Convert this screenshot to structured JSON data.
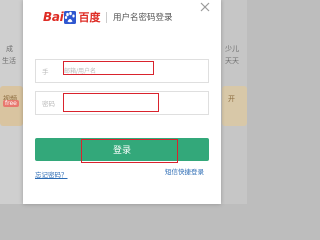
{
  "background": {
    "left_texts": [
      "成",
      "生活"
    ],
    "right_texts": [
      "少儿",
      "天天"
    ],
    "left_card_text": "视频",
    "right_card_text": "开",
    "badge_text": "free"
  },
  "modal": {
    "logo": {
      "part1": "Bai",
      "part2": "百度",
      "paw": "paw-icon"
    },
    "title": "用户名密码登录",
    "close_icon": "close-icon",
    "username": {
      "label": "手",
      "placeholder": "邮箱/用户名"
    },
    "password": {
      "label": "密码",
      "placeholder": ""
    },
    "login_button": "登录",
    "forgot_password": "忘记密码？",
    "sms_login": "短信快捷登录"
  },
  "colors": {
    "accent_green": "#33a87a",
    "brand_red": "#de2c25",
    "highlight_red": "#d9232d",
    "link_blue": "#2b6bb4"
  }
}
